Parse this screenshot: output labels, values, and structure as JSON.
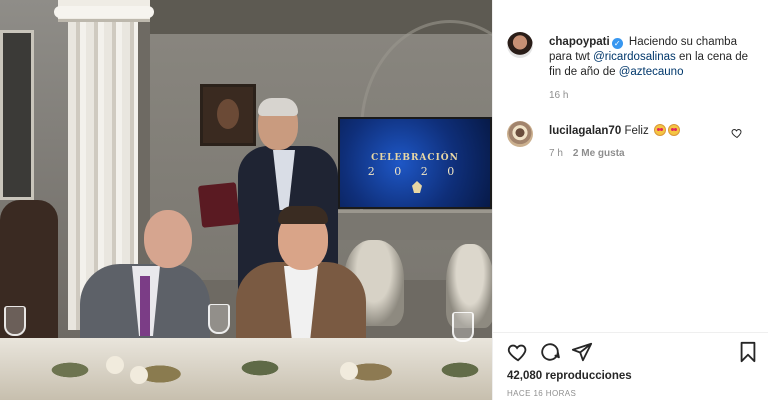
{
  "video": {
    "screen_title": "CELEBRACIÓN",
    "screen_year": "2 0 2 0"
  },
  "post": {
    "author": {
      "username": "chapoypati",
      "verified": true
    },
    "caption": {
      "text_1": "Haciendo su chamba para twt",
      "mention_1": "@ricardosalinas",
      "text_2": "en la cena de fin de año de",
      "mention_2": "@aztecauno"
    },
    "time": "16 h"
  },
  "comment": {
    "username": "lucilagalan70",
    "text": "Feliz",
    "emoji": [
      "heart-eyes-emoji",
      "heart-eyes-emoji"
    ],
    "time": "7 h",
    "likes": "2 Me gusta"
  },
  "actions": {
    "icons": [
      "heart-icon",
      "comment-icon",
      "share-icon",
      "bookmark-icon"
    ]
  },
  "stats": {
    "views": "42,080 reproducciones",
    "posted_ago": "HACE 16 HORAS"
  },
  "colors": {
    "mention": "#00376b",
    "verified": "#3897f0",
    "muted": "#8e8e8e",
    "text": "#262626"
  }
}
